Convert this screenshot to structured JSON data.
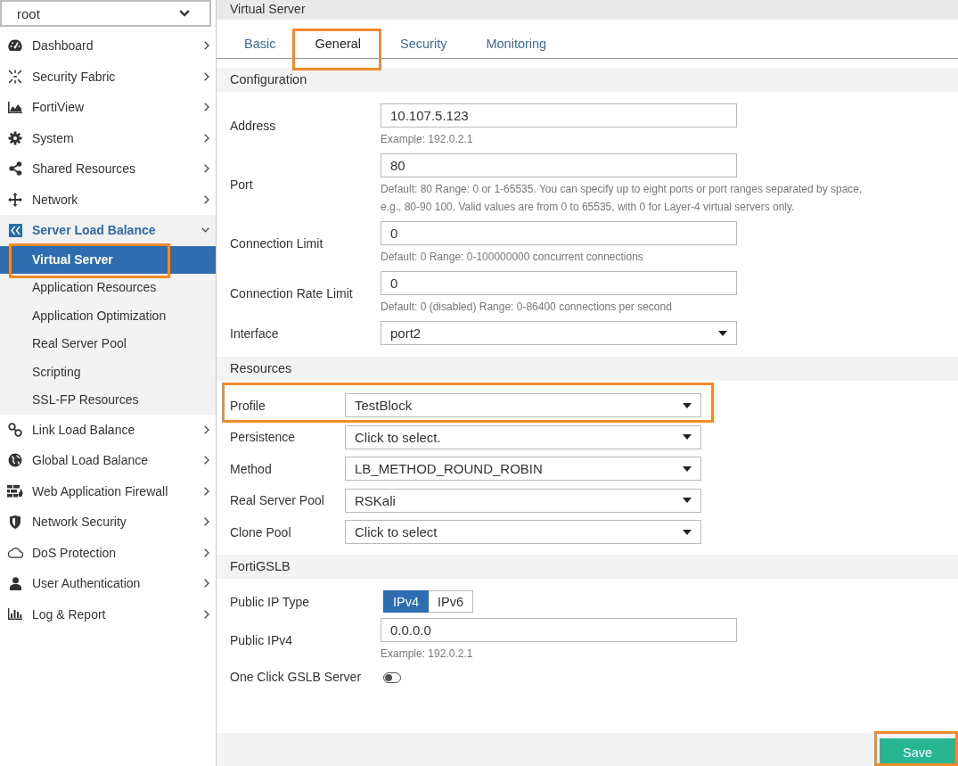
{
  "vdom_select": {
    "value": "root"
  },
  "sidebar": {
    "items": [
      {
        "label": "Dashboard",
        "expanded": false
      },
      {
        "label": "Security Fabric",
        "expanded": false
      },
      {
        "label": "FortiView",
        "expanded": false
      },
      {
        "label": "System",
        "expanded": false
      },
      {
        "label": "Shared Resources",
        "expanded": false
      },
      {
        "label": "Network",
        "expanded": false
      },
      {
        "label": "Server Load Balance",
        "expanded": true,
        "children": [
          {
            "label": "Virtual Server",
            "selected": true,
            "highlighted": true
          },
          {
            "label": "Application Resources",
            "selected": false,
            "highlighted": false
          },
          {
            "label": "Application Optimization",
            "selected": false,
            "highlighted": false
          },
          {
            "label": "Real Server Pool",
            "selected": false,
            "highlighted": false
          },
          {
            "label": "Scripting",
            "selected": false,
            "highlighted": false
          },
          {
            "label": "SSL-FP Resources",
            "selected": false,
            "highlighted": false
          }
        ]
      },
      {
        "label": "Link Load Balance",
        "expanded": false
      },
      {
        "label": "Global Load Balance",
        "expanded": false
      },
      {
        "label": "Web Application Firewall",
        "expanded": false
      },
      {
        "label": "Network Security",
        "expanded": false
      },
      {
        "label": "DoS Protection",
        "expanded": false
      },
      {
        "label": "User Authentication",
        "expanded": false
      },
      {
        "label": "Log & Report",
        "expanded": false
      }
    ]
  },
  "header": {
    "title": "Virtual Server"
  },
  "tabs": [
    {
      "label": "Basic",
      "selected": false,
      "highlighted": false
    },
    {
      "label": "General",
      "selected": true,
      "highlighted": true
    },
    {
      "label": "Security",
      "selected": false,
      "highlighted": false
    },
    {
      "label": "Monitoring",
      "selected": false,
      "highlighted": false
    }
  ],
  "sections": [
    {
      "title": "Configuration",
      "fields": [
        {
          "kind": "input",
          "label": "Address",
          "value": "10.107.5.123",
          "hint": "Example: 192.0.2.1"
        },
        {
          "kind": "input",
          "label": "Port",
          "value": "80",
          "hint": "Default: 80 Range: 0 or 1-65535. You can specify up to eight ports or port ranges separated by space, e.g., 80-90 100. Valid values are from 0 to 65535, with 0 for Layer-4 virtual servers only."
        },
        {
          "kind": "input",
          "label": "Connection Limit",
          "value": "0",
          "hint": "Default: 0 Range: 0-100000000 concurrent connections"
        },
        {
          "kind": "input",
          "label": "Connection Rate Limit",
          "value": "0",
          "hint": "Default: 0 (disabled) Range: 0-86400 connections per second"
        },
        {
          "kind": "select",
          "label": "Interface",
          "value": "port2"
        }
      ]
    },
    {
      "title": "Resources",
      "fields": [
        {
          "kind": "select",
          "label": "Profile",
          "value": "TestBlock",
          "highlighted": true
        },
        {
          "kind": "select",
          "label": "Persistence",
          "value": "Click to select.",
          "highlighted": false
        },
        {
          "kind": "select",
          "label": "Method",
          "value": "LB_METHOD_ROUND_ROBIN",
          "highlighted": false
        },
        {
          "kind": "select",
          "label": "Real Server Pool",
          "value": "RSKali",
          "highlighted": false
        },
        {
          "kind": "select",
          "label": "Clone Pool",
          "value": "Click to select",
          "highlighted": false
        }
      ]
    },
    {
      "title": "FortiGSLB",
      "fields": [
        {
          "kind": "segmented",
          "label": "Public IP Type",
          "options": [
            {
              "label": "IPv4",
              "selected": true
            },
            {
              "label": "IPv6",
              "selected": false
            }
          ]
        },
        {
          "kind": "input",
          "label": "Public IPv4",
          "value": "0.0.0.0",
          "hint": "Example: 192.0.2.1"
        },
        {
          "kind": "toggle",
          "label": "One Click GSLB Server",
          "on": false
        }
      ]
    }
  ],
  "footer": {
    "save_button": {
      "label": "Save",
      "highlighted": true
    }
  }
}
